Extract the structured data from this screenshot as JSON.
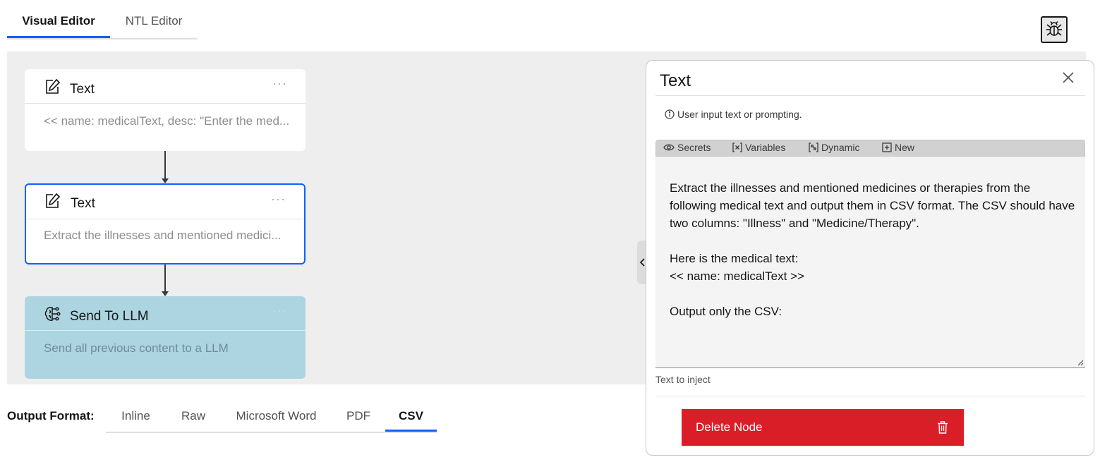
{
  "top_tabs": {
    "visual": "Visual Editor",
    "ntl": "NTL Editor"
  },
  "nodes": [
    {
      "title": "Text",
      "menu": "···",
      "preview": "<< name: medicalText, desc: \"Enter the med..."
    },
    {
      "title": "Text",
      "menu": "···",
      "preview": "Extract the illnesses and mentioned medici..."
    },
    {
      "title": "Send To LLM",
      "menu": "···",
      "preview": "Send all previous content to a LLM"
    }
  ],
  "output_format": {
    "label": "Output Format:",
    "options": [
      "Inline",
      "Raw",
      "Microsoft Word",
      "PDF",
      "CSV"
    ],
    "selected": "CSV"
  },
  "panel": {
    "title": "Text",
    "info": "User input text or prompting.",
    "toolbar": {
      "secrets": "Secrets",
      "variables": "Variables",
      "dynamic": "Dynamic",
      "new": "New"
    },
    "text": "Extract the illnesses and mentioned medicines or therapies from the following medical text and output them in CSV format. The CSV should have two columns: \"Illness\" and \"Medicine/Therapy\".\n\nHere is the medical text:\n<< name: medicalText >>\n\nOutput only the CSV:",
    "helper": "Text to inject",
    "delete_label": "Delete Node"
  },
  "colors": {
    "accent": "#0f62fe",
    "danger": "#da1e28",
    "llm_node": "#acd5e1",
    "canvas": "#eeeeee"
  },
  "icons": [
    "edit-icon",
    "brain-icon",
    "bug-icon",
    "close-icon",
    "info-icon",
    "eye-icon",
    "variable-icon",
    "dynamic-icon",
    "add-icon",
    "trash-icon",
    "chevron-left-icon"
  ]
}
